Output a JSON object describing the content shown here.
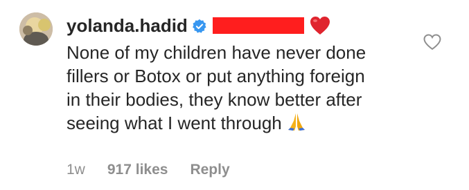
{
  "comment": {
    "username": "yolanda.hadid",
    "text_line1_tail": "None",
    "text_body": "of my children have never done fillers or Botox or put anything foreign in their bodies, they know better after seeing what I went through",
    "verified_icon": "verified-badge",
    "emoji_after_name": "red-heart",
    "emoji_end": "folded-hands",
    "redaction_color": "#ff1e1e"
  },
  "meta": {
    "age": "1w",
    "likes": "917 likes",
    "reply_label": "Reply"
  },
  "colors": {
    "text": "#262626",
    "meta": "#8e8e8e",
    "verified": "#3897f0"
  }
}
